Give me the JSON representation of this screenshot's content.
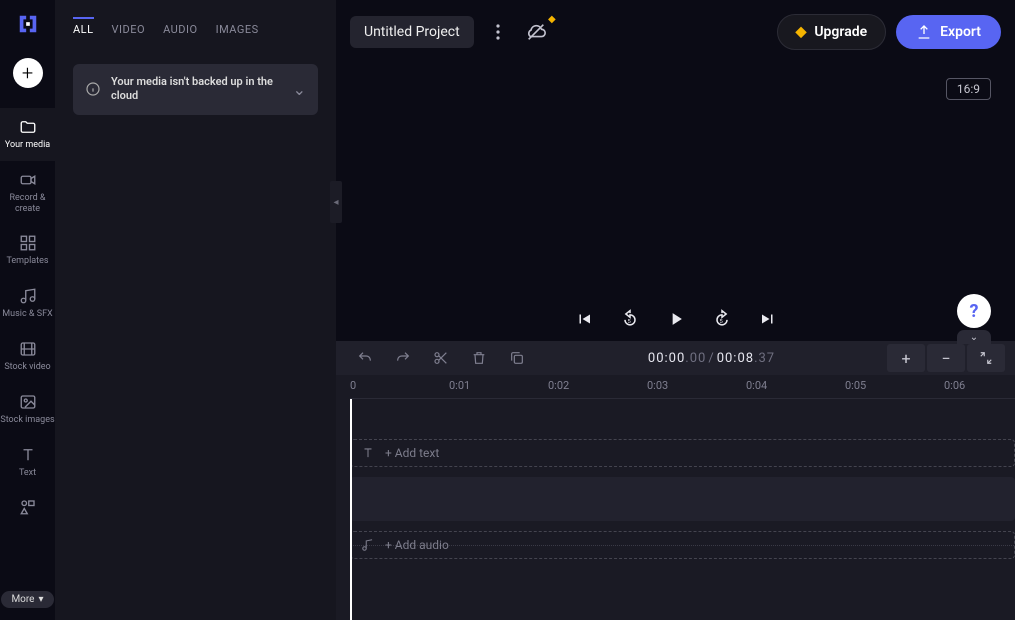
{
  "rail": {
    "items": [
      {
        "key": "your-media",
        "label": "Your media"
      },
      {
        "key": "record-create",
        "label": "Record & create"
      },
      {
        "key": "templates",
        "label": "Templates"
      },
      {
        "key": "music-sfx",
        "label": "Music & SFX"
      },
      {
        "key": "stock-video",
        "label": "Stock video"
      },
      {
        "key": "stock-images",
        "label": "Stock images"
      },
      {
        "key": "text",
        "label": "Text"
      }
    ],
    "more_label": "More"
  },
  "tabs": [
    "ALL",
    "VIDEO",
    "AUDIO",
    "IMAGES"
  ],
  "notice": {
    "text": "Your media isn't backed up in the cloud"
  },
  "topbar": {
    "title": "Untitled Project",
    "upgrade": "Upgrade",
    "export": "Export",
    "aspect": "16:9"
  },
  "timecode": {
    "current": "00:00",
    "current_frac": ".00",
    "total": "00:08",
    "total_frac": ".37"
  },
  "ruler": {
    "ticks": [
      "0",
      "0:01",
      "0:02",
      "0:03",
      "0:04",
      "0:05",
      "0:06"
    ]
  },
  "tracks": {
    "add_text": "+ Add text",
    "add_audio": "+ Add audio"
  },
  "help": "?"
}
